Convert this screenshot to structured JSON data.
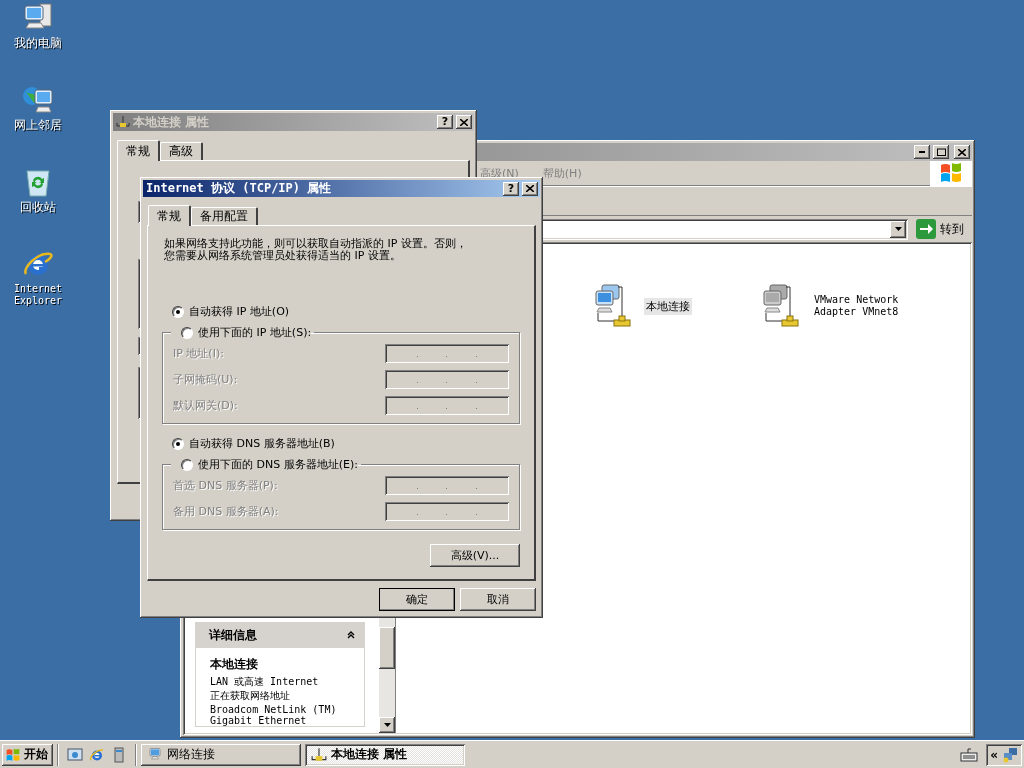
{
  "desktop_icons": [
    {
      "kind": "computer",
      "label": "我的电脑"
    },
    {
      "kind": "network",
      "label": "网上邻居"
    },
    {
      "kind": "recycle",
      "label": "回收站"
    },
    {
      "kind": "browser",
      "label": "Internet Explorer"
    }
  ],
  "explorer_window": {
    "menu": [
      "高级(N)",
      "帮助(H)"
    ],
    "go_button": "转到",
    "connections": [
      {
        "name": "本地连接",
        "selected": true,
        "disabled": false
      },
      {
        "name": "VMware Network Adapter VMnet8",
        "selected": false,
        "disabled": true
      }
    ],
    "details": {
      "title": "详细信息",
      "name": "本地连接",
      "lines": [
        "LAN 或高速 Internet",
        "正在获取网络地址",
        "Broadcom NetLink (TM) Gigabit Ethernet"
      ]
    }
  },
  "connection_properties": {
    "title": "本地连接 属性",
    "help_button": "?",
    "tabs": [
      {
        "label": "常规",
        "selected": true
      },
      {
        "label": "高级",
        "selected": false
      }
    ]
  },
  "tcpip_properties": {
    "title": "Internet 协议 (TCP/IP) 属性",
    "help_button": "?",
    "tabs": [
      {
        "label": "常规",
        "selected": true
      },
      {
        "label": "备用配置",
        "selected": false
      }
    ],
    "description": "如果网络支持此功能，则可以获取自动指派的 IP 设置。否则，您需要从网络系统管理员处获得适当的 IP 设置。",
    "ip_auto": {
      "label": "自动获得 IP 地址(O)",
      "selected": true
    },
    "ip_manual": {
      "label": "使用下面的 IP 地址(S):",
      "selected": false
    },
    "ip_fields": [
      {
        "label": "IP 地址(I):",
        "disabled": true
      },
      {
        "label": "子网掩码(U):",
        "disabled": true
      },
      {
        "label": "默认网关(D):",
        "disabled": true
      }
    ],
    "dns_auto": {
      "label": "自动获得 DNS 服务器地址(B)",
      "selected": true
    },
    "dns_manual": {
      "label": "使用下面的 DNS 服务器地址(E):",
      "selected": false
    },
    "dns_fields": [
      {
        "label": "首选 DNS 服务器(P):",
        "disabled": true
      },
      {
        "label": "备用 DNS 服务器(A):",
        "disabled": true
      }
    ],
    "advanced_button": "高级(V)...",
    "ok_button": "确定",
    "cancel_button": "取消"
  },
  "taskbar": {
    "start": "开始",
    "tasks": [
      {
        "label": "网络连接",
        "selected": false
      },
      {
        "label": "本地连接 属性",
        "selected": true
      }
    ],
    "tray_expand": "«"
  }
}
